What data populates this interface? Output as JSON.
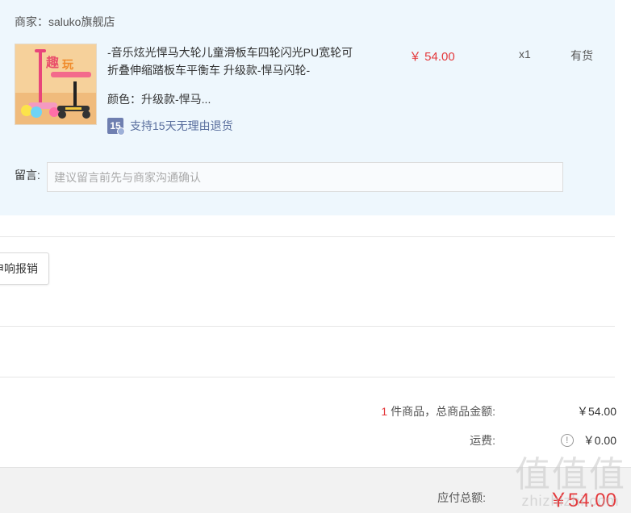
{
  "shop": {
    "label": "商家：",
    "name": "saluko旗舰店"
  },
  "item": {
    "title": "-音乐炫光悍马大轮儿童滑板车四轮闪光PU宽轮可折叠伸缩踏板车平衡车 升级款-悍马闪轮-",
    "spec": "颜色：升级款-悍马...",
    "return_badge": "15",
    "return_text": "支持15天无理由退货",
    "price": "￥ 54.00",
    "qty": "x1",
    "stock": "有货"
  },
  "message": {
    "label": "留言:",
    "placeholder": "建议留言前先与商家沟通确认"
  },
  "reimburse_button": "申响报销",
  "summary": {
    "count": "1",
    "goods_label": " 件商品，总商品金额:",
    "goods_total": "￥54.00",
    "shipping_label": "运费:",
    "shipping_icon": "info-icon",
    "shipping_value": "￥0.00",
    "payable_label": "应付总额:",
    "payable_value": "￥54.00"
  },
  "watermark": {
    "glyphs": "值值值",
    "url": "zhizhizhi.com"
  },
  "colors": {
    "accent_red": "#e4393c",
    "panel_bg": "#eef7fd"
  }
}
